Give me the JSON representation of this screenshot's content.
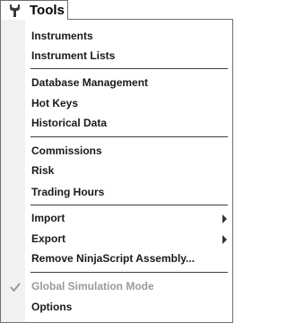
{
  "menu": {
    "title": "Tools",
    "icon": "wrench-icon"
  },
  "items": {
    "instruments": "Instruments",
    "instrument_lists": "Instrument Lists",
    "database_management": "Database Management",
    "hot_keys": "Hot Keys",
    "historical_data": "Historical Data",
    "commissions": "Commissions",
    "risk": "Risk",
    "trading_hours": "Trading Hours",
    "import": "Import",
    "export": "Export",
    "remove_assembly": "Remove NinjaScript Assembly...",
    "global_simulation_mode": "Global Simulation Mode",
    "options": "Options"
  },
  "colors": {
    "gutter": "#f1f1f1",
    "border": "#6f6f6f",
    "disabled_text": "#9a9a9a"
  }
}
